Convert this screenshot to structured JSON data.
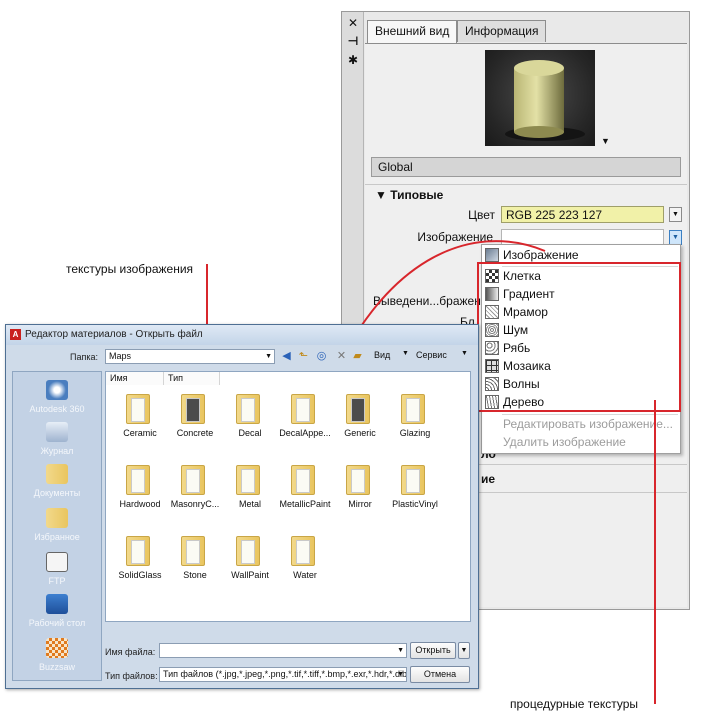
{
  "palette": {
    "strip_icons": [
      "close-icon",
      "autohide-icon",
      "properties-icon"
    ],
    "tabs": [
      "Внешний вид",
      "Информация"
    ],
    "material_name": "Global",
    "section_generic": "▼ Типовые",
    "color_label": "Цвет",
    "color_value": "RGB 225 223 127",
    "image_label": "Изображение",
    "faded_label": "Выведени...бражен",
    "faded_label2": "Бл",
    "hidden_fragment_1": "ло",
    "hidden_fragment_2": "ие"
  },
  "menu": {
    "items": [
      {
        "label": "Изображение",
        "enabled": true
      },
      {
        "label": "Клетка",
        "enabled": true
      },
      {
        "label": "Градиент",
        "enabled": true
      },
      {
        "label": "Мрамор",
        "enabled": true
      },
      {
        "label": "Шум",
        "enabled": true
      },
      {
        "label": "Рябь",
        "enabled": true
      },
      {
        "label": "Мозаика",
        "enabled": true
      },
      {
        "label": "Волны",
        "enabled": true
      },
      {
        "label": "Дерево",
        "enabled": true
      },
      {
        "label": "Редактировать изображение...",
        "enabled": false
      },
      {
        "label": "Удалить изображение",
        "enabled": false
      }
    ]
  },
  "callouts": {
    "image_textures": "текстуры изображения",
    "procedural_textures": "процедурные текстуры"
  },
  "dialog": {
    "title": "Редактор материалов - Открыть файл",
    "folder_label": "Папка:",
    "folder_value": "Maps",
    "view_label": "Вид",
    "tools_label": "Сервис",
    "columns": [
      "Имя",
      "Тип"
    ],
    "places": [
      "Autodesk 360",
      "Журнал",
      "Документы",
      "Избранное",
      "FTP",
      "Рабочий стол",
      "Buzzsaw"
    ],
    "files": [
      "Ceramic",
      "Concrete",
      "Decal",
      "DecalAppe...",
      "Generic",
      "Glazing",
      "Hardwood",
      "MasonryC...",
      "Metal",
      "MetallicPaint",
      "Mirror",
      "PlasticVinyl",
      "SolidGlass",
      "Stone",
      "WallPaint",
      "Water"
    ],
    "filename_label": "Имя файла:",
    "filename_value": "",
    "filetype_label": "Тип файлов:",
    "filetype_value": "Тип файлов (*.jpg,*.jpeg,*.png,*.tif,*.tiff,*.bmp,*.exr,*.hdr,*.dib,*.pcx",
    "open_button": "Открыть",
    "cancel_button": "Отмена"
  }
}
